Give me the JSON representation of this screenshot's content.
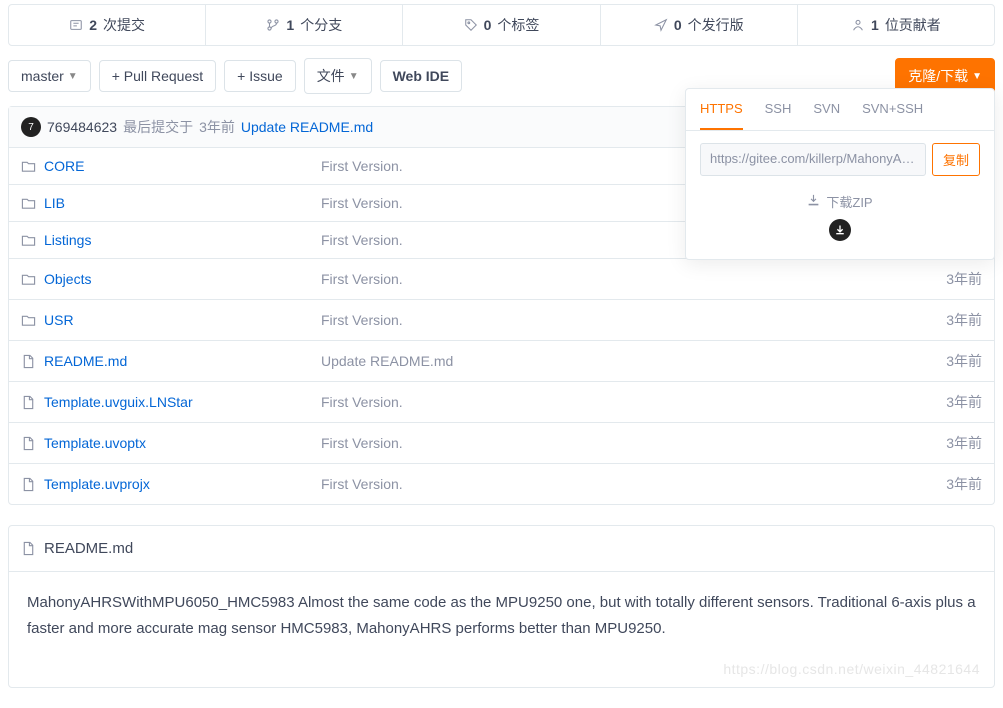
{
  "stats": [
    {
      "icon": "commits",
      "num": "2",
      "label": "次提交"
    },
    {
      "icon": "branch",
      "num": "1",
      "label": "个分支"
    },
    {
      "icon": "tag",
      "num": "0",
      "label": "个标签"
    },
    {
      "icon": "release",
      "num": "0",
      "label": "个发行版"
    },
    {
      "icon": "contrib",
      "num": "1",
      "label": "位贡献者"
    }
  ],
  "toolbar": {
    "branch": "master",
    "pr": "+ Pull Request",
    "issue": "+ Issue",
    "file": "文件",
    "webide": "Web IDE",
    "clone": "克隆/下载"
  },
  "commit": {
    "avatar_text": "7",
    "user": "769484623",
    "meta1": "最后提交于",
    "time": "3年前",
    "msg": "Update README.md"
  },
  "files": [
    {
      "type": "folder",
      "name": "CORE",
      "msg": "First Version.",
      "time": ""
    },
    {
      "type": "folder",
      "name": "LIB",
      "msg": "First Version.",
      "time": ""
    },
    {
      "type": "folder",
      "name": "Listings",
      "msg": "First Version.",
      "time": ""
    },
    {
      "type": "folder",
      "name": "Objects",
      "msg": "First Version.",
      "time": "3年前"
    },
    {
      "type": "folder",
      "name": "USR",
      "msg": "First Version.",
      "time": "3年前"
    },
    {
      "type": "file",
      "name": "README.md",
      "msg": "Update README.md",
      "time": "3年前"
    },
    {
      "type": "file",
      "name": "Template.uvguix.LNStar",
      "msg": "First Version.",
      "time": "3年前"
    },
    {
      "type": "file",
      "name": "Template.uvoptx",
      "msg": "First Version.",
      "time": "3年前"
    },
    {
      "type": "file",
      "name": "Template.uvprojx",
      "msg": "First Version.",
      "time": "3年前"
    }
  ],
  "readme": {
    "title": "README.md",
    "body": "MahonyAHRSWithMPU6050_HMC5983 Almost the same code as the MPU9250 one, but with totally different sensors. Traditional 6-axis plus a faster and more accurate mag sensor HMC5983, MahonyAHRS performs better than MPU9250."
  },
  "watermark": "https://blog.csdn.net/weixin_44821644",
  "popover": {
    "tabs": [
      "HTTPS",
      "SSH",
      "SVN",
      "SVN+SSH"
    ],
    "url": "https://gitee.com/killerp/MahonyAHRS…",
    "copy": "复制",
    "zip_label": "下载ZIP"
  }
}
